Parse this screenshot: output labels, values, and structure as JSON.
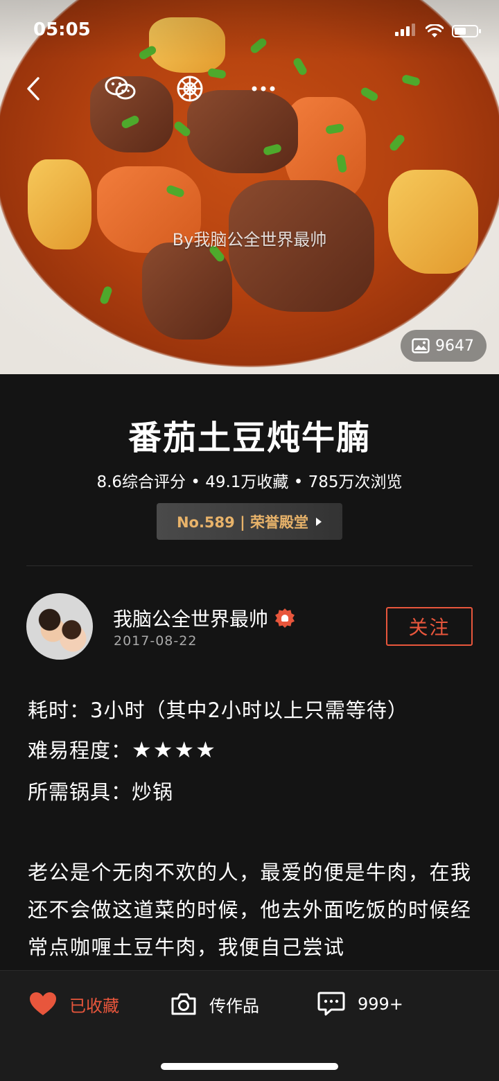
{
  "status_bar": {
    "time": "05:05"
  },
  "hero": {
    "watermark": "By我脑公全世界最帅",
    "photo_count": "9647"
  },
  "recipe": {
    "title": "番茄土豆炖牛腩",
    "stats": "8.6综合评分 • 49.1万收藏 • 785万次浏览",
    "rank_label": "No.589 | 荣誉殿堂"
  },
  "author": {
    "name": "我脑公全世界最帅",
    "date": "2017-08-22",
    "follow_label": "关注"
  },
  "info": {
    "time_label": "耗时：",
    "time_value": "3小时（其中2小时以上只需等待）",
    "difficulty_label": "难易程度：",
    "difficulty_stars": "★★★★",
    "tools_label": "所需锅具：",
    "tools_value": "炒锅"
  },
  "description": "老公是个无肉不欢的人，最爱的便是牛肉，在我还不会做这道菜的时候，他去外面吃饭的时候经常点咖喱土豆牛肉，我便自己尝试",
  "tabbar": {
    "favorite_label": "已收藏",
    "upload_label": "传作品",
    "comments_count": "999+"
  },
  "colors": {
    "accent": "#e8563c",
    "gold": "#e8b36a",
    "background": "#141414"
  }
}
